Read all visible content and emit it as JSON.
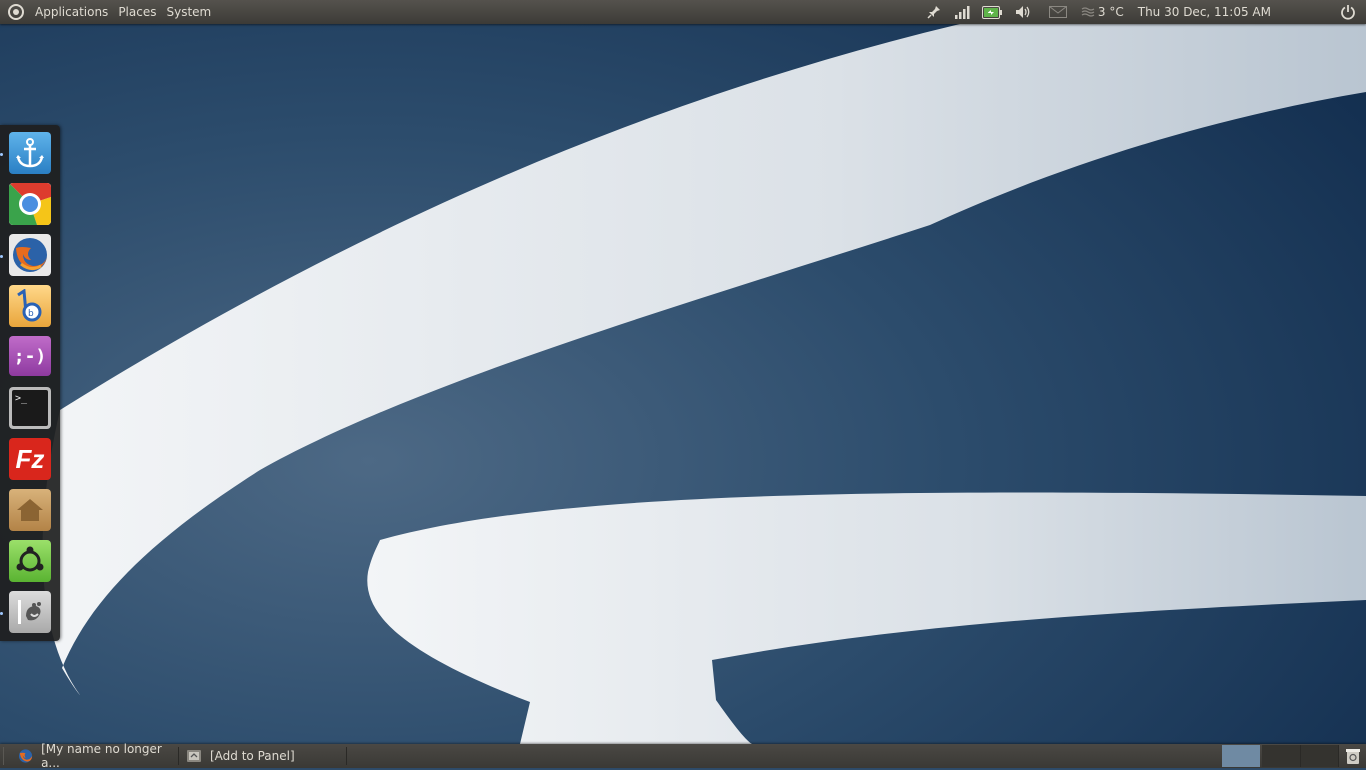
{
  "top_panel": {
    "menus": [
      "Applications",
      "Places",
      "System"
    ],
    "weather": "3 °C",
    "clock": "Thu 30 Dec, 11:05 AM",
    "icons": [
      "pin-icon",
      "signal-icon",
      "battery-icon",
      "volume-icon",
      "mail-icon",
      "weather-icon",
      "power-icon"
    ]
  },
  "dock": {
    "items": [
      {
        "name": "anchor",
        "running": true
      },
      {
        "name": "chrome",
        "running": false
      },
      {
        "name": "firefox",
        "running": true
      },
      {
        "name": "bluefish",
        "running": false
      },
      {
        "name": "empathy",
        "running": false
      },
      {
        "name": "terminal",
        "running": false
      },
      {
        "name": "filezilla",
        "running": false
      },
      {
        "name": "home-folder",
        "running": false
      },
      {
        "name": "ubuntu-software-center",
        "running": false
      },
      {
        "name": "gimp",
        "running": true
      }
    ]
  },
  "bottom_panel": {
    "tasks": [
      {
        "label": "[My name no longer a...",
        "icon": "firefox-icon"
      },
      {
        "label": "[Add to Panel]",
        "icon": "panel-icon"
      }
    ],
    "workspaces": 4,
    "active_workspace": 1
  },
  "colors": {
    "panel": "#3c3b37",
    "desktop_dark": "#1d3a5c",
    "desktop_light": "#e8ecf0"
  }
}
